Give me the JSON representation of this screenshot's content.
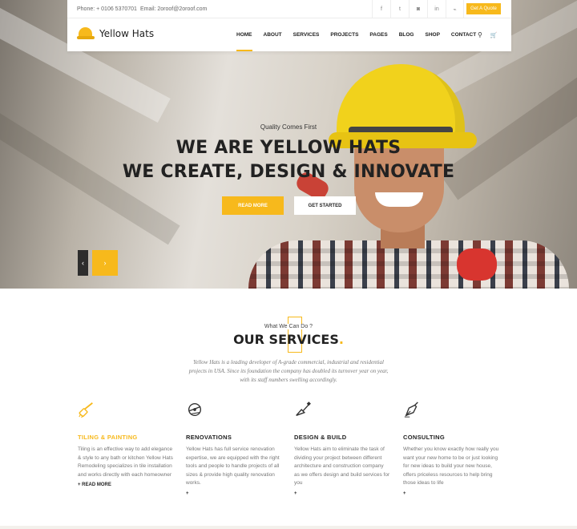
{
  "topbar": {
    "phone": "Phone: + 0106 5370701",
    "email": "Email: 2oroof@2oroof.com",
    "social_icons": [
      "f",
      "t",
      "◙",
      "in",
      "⌁"
    ],
    "quote_label": "Get A Quote"
  },
  "logo": {
    "text": "Yellow Hats"
  },
  "nav": {
    "items": [
      "HOME",
      "ABOUT",
      "SERVICES",
      "PROJECTS",
      "PAGES",
      "BLOG",
      "SHOP",
      "CONTACT"
    ],
    "search_icon": "⚲",
    "cart_icon": "🛒"
  },
  "hero": {
    "tagline": "Quality Comes First",
    "line1": "WE ARE YELLOW HATS",
    "line2": "WE CREATE, DESIGN & INNOVATE",
    "read_more": "READ MORE",
    "get_started": "GET STARTED",
    "prev": "‹",
    "next": "›"
  },
  "services": {
    "kicker": "What We Can Do ?",
    "title": "OUR SERVICES",
    "title_dot": ".",
    "description": "Yellow Hats is a leading developer of A-grade commercial, industrial and residential projects in USA. Since its foundation the company has doubled its turnover year on year, with its staff numbers swelling accordingly.",
    "items": [
      {
        "title": "TILING & PAINTING",
        "text": "Tiling is an effective way to add elegance & style to any bath or kitchen Yellow Hats Remodeling specializes in tile installation and works directly with each homeowner",
        "more": "+ READ MORE",
        "icon": "brush-icon"
      },
      {
        "title": "RENOVATIONS",
        "text": "Yellow Hats has full service renovation expertise, we are equipped with the right tools and people to handle projects of all sizes & provide high quality renovation works.",
        "more": "+",
        "icon": "saw-icon"
      },
      {
        "title": "DESIGN & BUILD",
        "text": "Yellow Hats aim to eliminate the task of dividing your project between different architecture and construction company as we offers design and build services for you",
        "more": "+",
        "icon": "trowel-icon"
      },
      {
        "title": "CONSULTING",
        "text": "Whether you know exactly how really you want your new home to be or just looking for new ideas to build your new house, offers priceless resources to help bring those ideas to life",
        "more": "+",
        "icon": "pen-nib-icon"
      }
    ]
  },
  "colors": {
    "accent": "#f7b91c",
    "dark": "#222222"
  }
}
